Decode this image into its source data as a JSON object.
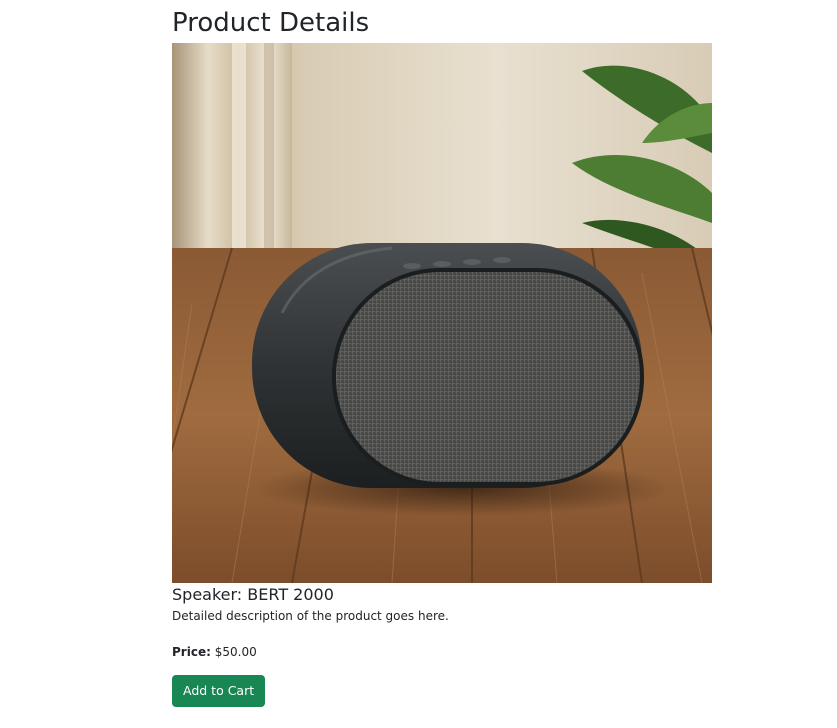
{
  "page": {
    "title": "Product Details"
  },
  "product": {
    "name": "Speaker: BERT 2000",
    "description": "Detailed description of the product goes here.",
    "price_label": "Price:",
    "price_value": "$50.00",
    "image_alt": "speaker-product-photo"
  },
  "actions": {
    "add_to_cart_label": "Add to Cart"
  },
  "colors": {
    "primary_button": "#198754",
    "text": "#212529"
  }
}
